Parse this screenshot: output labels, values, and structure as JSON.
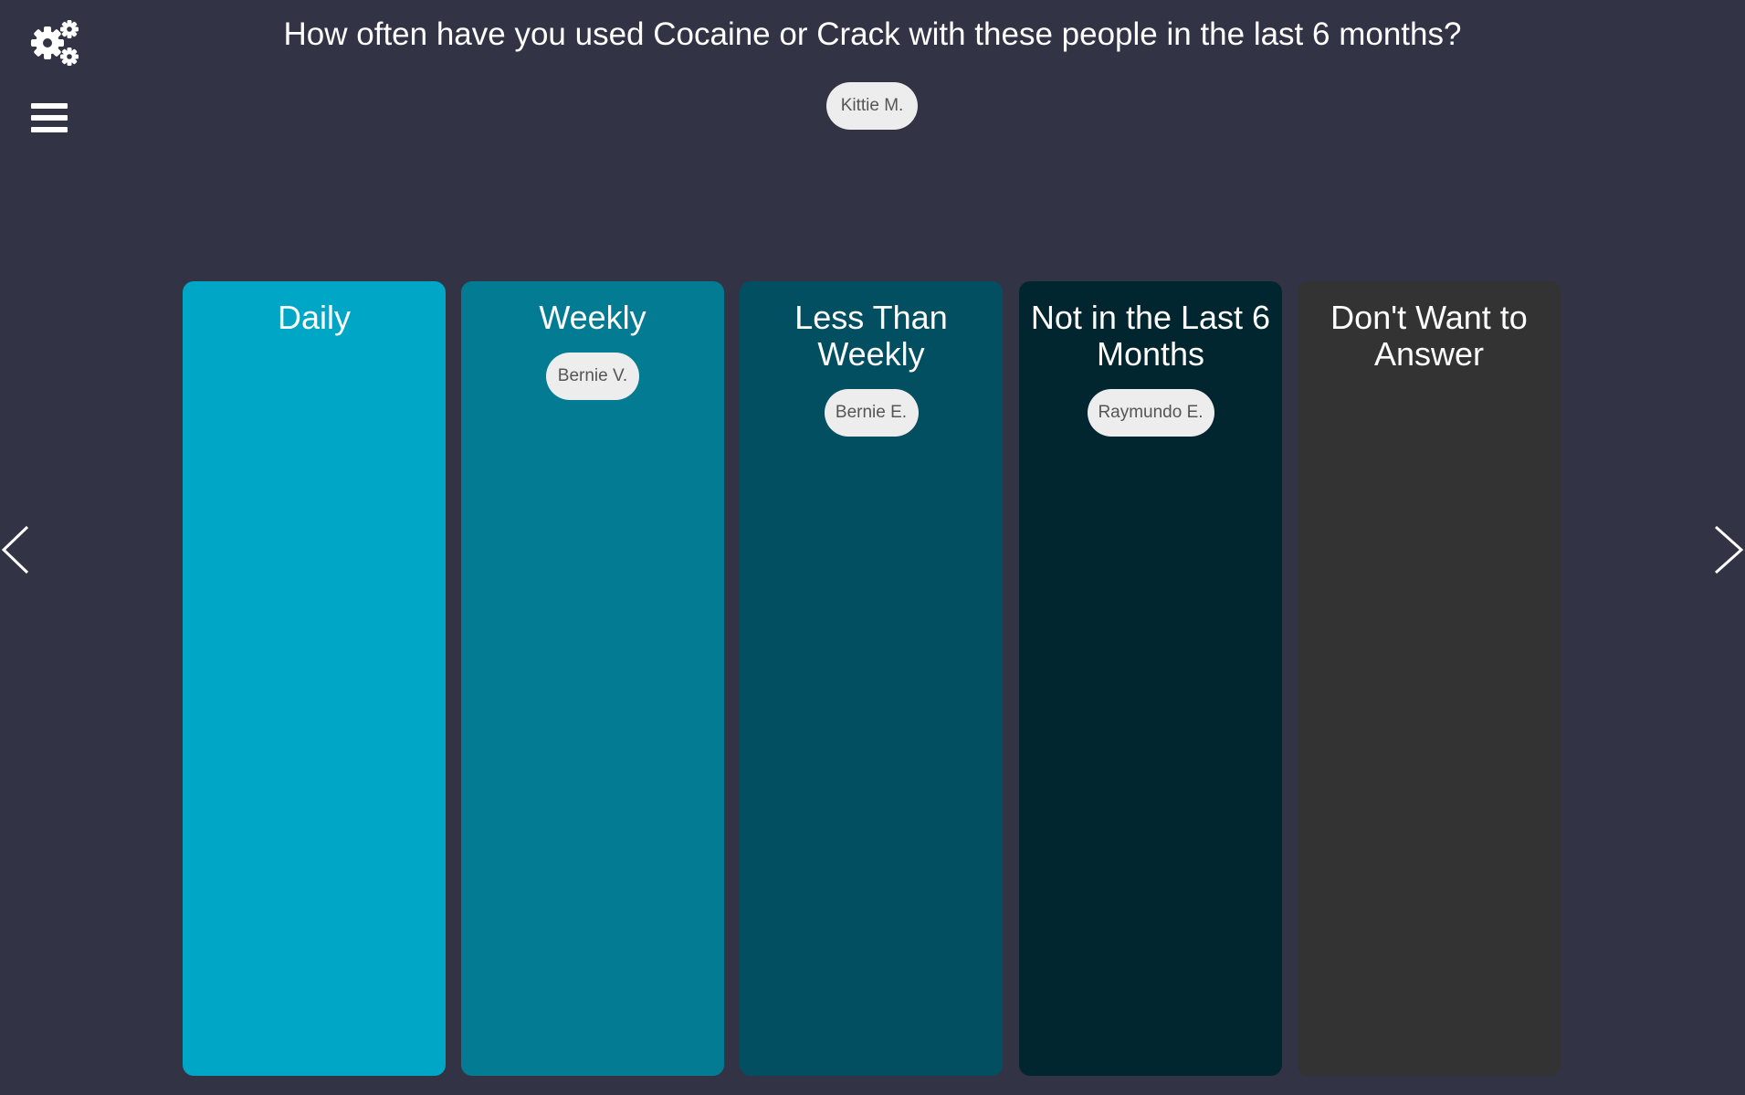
{
  "header": {
    "question": "How often have you used Cocaine or Crack with these people in the last 6 months?",
    "settings_icon": "gear-icon",
    "menu_icon": "hamburger-menu-icon"
  },
  "pending": {
    "chip_label": "Kittie M."
  },
  "columns": [
    {
      "label": "Daily",
      "color": "#00a6c6",
      "chips": []
    },
    {
      "label": "Weekly",
      "color": "#037b93",
      "chips": [
        "Bernie V."
      ]
    },
    {
      "label": "Less Than Weekly",
      "color": "#024f62",
      "chips": [
        "Bernie E."
      ]
    },
    {
      "label": "Not in the Last 6 Months",
      "color": "#012630",
      "chips": [
        "Raymundo E."
      ]
    },
    {
      "label": "Don't Want to Answer",
      "color": "#333333",
      "chips": []
    }
  ],
  "navigation": {
    "prev_icon": "chevron-left-icon",
    "next_icon": "chevron-right-icon"
  },
  "theme": {
    "background": "#323345",
    "chip_background": "#ededed"
  }
}
